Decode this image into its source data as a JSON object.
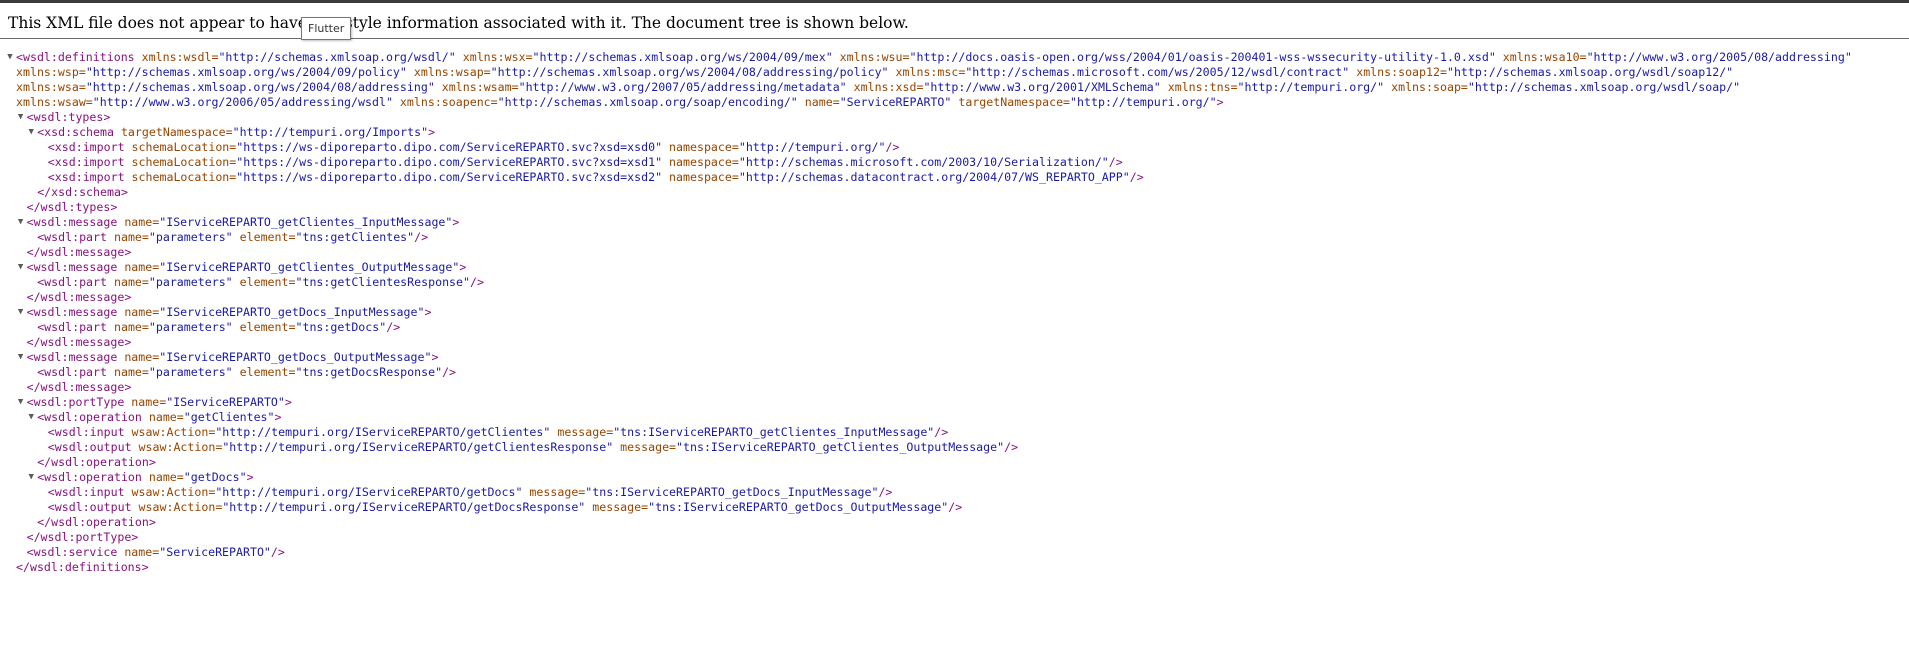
{
  "header": {
    "message": "This XML file does not appear to have any style information associated with it. The document tree is shown below.",
    "tooltip": "Flutter"
  },
  "tree": {
    "lines": [
      {
        "depth": 0,
        "toggle": true,
        "parts": [
          [
            "t",
            "<wsdl:definitions"
          ],
          [
            "an",
            " xmlns:wsdl="
          ],
          [
            "av",
            "\"http://schemas.xmlsoap.org/wsdl/\""
          ],
          [
            "an",
            " xmlns:wsx="
          ],
          [
            "av",
            "\"http://schemas.xmlsoap.org/ws/2004/09/mex\""
          ],
          [
            "an",
            " xmlns:wsu="
          ],
          [
            "av",
            "\"http://docs.oasis-open.org/wss/2004/01/oasis-200401-wss-wssecurity-utility-1.0.xsd\""
          ],
          [
            "an",
            " xmlns:wsa10="
          ],
          [
            "av",
            "\"http://www.w3.org/2005/08/addressing\""
          ]
        ]
      },
      {
        "depth": 0,
        "wrap": true,
        "parts": [
          [
            "an",
            "xmlns:wsp="
          ],
          [
            "av",
            "\"http://schemas.xmlsoap.org/ws/2004/09/policy\""
          ],
          [
            "an",
            " xmlns:wsap="
          ],
          [
            "av",
            "\"http://schemas.xmlsoap.org/ws/2004/08/addressing/policy\""
          ],
          [
            "an",
            " xmlns:msc="
          ],
          [
            "av",
            "\"http://schemas.microsoft.com/ws/2005/12/wsdl/contract\""
          ],
          [
            "an",
            " xmlns:soap12="
          ],
          [
            "av",
            "\"http://schemas.xmlsoap.org/wsdl/soap12/\""
          ]
        ]
      },
      {
        "depth": 0,
        "wrap": true,
        "parts": [
          [
            "an",
            "xmlns:wsa="
          ],
          [
            "av",
            "\"http://schemas.xmlsoap.org/ws/2004/08/addressing\""
          ],
          [
            "an",
            " xmlns:wsam="
          ],
          [
            "av",
            "\"http://www.w3.org/2007/05/addressing/metadata\""
          ],
          [
            "an",
            " xmlns:xsd="
          ],
          [
            "av",
            "\"http://www.w3.org/2001/XMLSchema\""
          ],
          [
            "an",
            " xmlns:tns="
          ],
          [
            "av",
            "\"http://tempuri.org/\""
          ],
          [
            "an",
            " xmlns:soap="
          ],
          [
            "av",
            "\"http://schemas.xmlsoap.org/wsdl/soap/\""
          ]
        ]
      },
      {
        "depth": 0,
        "wrap": true,
        "parts": [
          [
            "an",
            "xmlns:wsaw="
          ],
          [
            "av",
            "\"http://www.w3.org/2006/05/addressing/wsdl\""
          ],
          [
            "an",
            " xmlns:soapenc="
          ],
          [
            "av",
            "\"http://schemas.xmlsoap.org/soap/encoding/\""
          ],
          [
            "an",
            " name="
          ],
          [
            "av",
            "\"ServiceREPARTO\""
          ],
          [
            "an",
            " targetNamespace="
          ],
          [
            "av",
            "\"http://tempuri.org/\""
          ],
          [
            "t",
            ">"
          ]
        ]
      },
      {
        "depth": 1,
        "toggle": true,
        "parts": [
          [
            "t",
            "<wsdl:types>"
          ]
        ]
      },
      {
        "depth": 2,
        "toggle": true,
        "parts": [
          [
            "t",
            "<xsd:schema"
          ],
          [
            "an",
            " targetNamespace="
          ],
          [
            "av",
            "\"http://tempuri.org/Imports\""
          ],
          [
            "t",
            ">"
          ]
        ]
      },
      {
        "depth": 3,
        "parts": [
          [
            "t",
            "<xsd:import"
          ],
          [
            "an",
            " schemaLocation="
          ],
          [
            "av",
            "\"https://ws-diporeparto.dipo.com/ServiceREPARTO.svc?xsd=xsd0\""
          ],
          [
            "an",
            " namespace="
          ],
          [
            "av",
            "\"http://tempuri.org/\""
          ],
          [
            "t",
            "/>"
          ]
        ]
      },
      {
        "depth": 3,
        "parts": [
          [
            "t",
            "<xsd:import"
          ],
          [
            "an",
            " schemaLocation="
          ],
          [
            "av",
            "\"https://ws-diporeparto.dipo.com/ServiceREPARTO.svc?xsd=xsd1\""
          ],
          [
            "an",
            " namespace="
          ],
          [
            "av",
            "\"http://schemas.microsoft.com/2003/10/Serialization/\""
          ],
          [
            "t",
            "/>"
          ]
        ]
      },
      {
        "depth": 3,
        "parts": [
          [
            "t",
            "<xsd:import"
          ],
          [
            "an",
            " schemaLocation="
          ],
          [
            "av",
            "\"https://ws-diporeparto.dipo.com/ServiceREPARTO.svc?xsd=xsd2\""
          ],
          [
            "an",
            " namespace="
          ],
          [
            "av",
            "\"http://schemas.datacontract.org/2004/07/WS_REPARTO_APP\""
          ],
          [
            "t",
            "/>"
          ]
        ]
      },
      {
        "depth": 2,
        "parts": [
          [
            "t",
            "</xsd:schema>"
          ]
        ]
      },
      {
        "depth": 1,
        "parts": [
          [
            "t",
            "</wsdl:types>"
          ]
        ]
      },
      {
        "depth": 1,
        "toggle": true,
        "parts": [
          [
            "t",
            "<wsdl:message"
          ],
          [
            "an",
            " name="
          ],
          [
            "av",
            "\"IServiceREPARTO_getClientes_InputMessage\""
          ],
          [
            "t",
            ">"
          ]
        ]
      },
      {
        "depth": 2,
        "parts": [
          [
            "t",
            "<wsdl:part"
          ],
          [
            "an",
            " name="
          ],
          [
            "av",
            "\"parameters\""
          ],
          [
            "an",
            " element="
          ],
          [
            "av",
            "\"tns:getClientes\""
          ],
          [
            "t",
            "/>"
          ]
        ]
      },
      {
        "depth": 1,
        "parts": [
          [
            "t",
            "</wsdl:message>"
          ]
        ]
      },
      {
        "depth": 1,
        "toggle": true,
        "parts": [
          [
            "t",
            "<wsdl:message"
          ],
          [
            "an",
            " name="
          ],
          [
            "av",
            "\"IServiceREPARTO_getClientes_OutputMessage\""
          ],
          [
            "t",
            ">"
          ]
        ]
      },
      {
        "depth": 2,
        "parts": [
          [
            "t",
            "<wsdl:part"
          ],
          [
            "an",
            " name="
          ],
          [
            "av",
            "\"parameters\""
          ],
          [
            "an",
            " element="
          ],
          [
            "av",
            "\"tns:getClientesResponse\""
          ],
          [
            "t",
            "/>"
          ]
        ]
      },
      {
        "depth": 1,
        "parts": [
          [
            "t",
            "</wsdl:message>"
          ]
        ]
      },
      {
        "depth": 1,
        "toggle": true,
        "parts": [
          [
            "t",
            "<wsdl:message"
          ],
          [
            "an",
            " name="
          ],
          [
            "av",
            "\"IServiceREPARTO_getDocs_InputMessage\""
          ],
          [
            "t",
            ">"
          ]
        ]
      },
      {
        "depth": 2,
        "parts": [
          [
            "t",
            "<wsdl:part"
          ],
          [
            "an",
            " name="
          ],
          [
            "av",
            "\"parameters\""
          ],
          [
            "an",
            " element="
          ],
          [
            "av",
            "\"tns:getDocs\""
          ],
          [
            "t",
            "/>"
          ]
        ]
      },
      {
        "depth": 1,
        "parts": [
          [
            "t",
            "</wsdl:message>"
          ]
        ]
      },
      {
        "depth": 1,
        "toggle": true,
        "parts": [
          [
            "t",
            "<wsdl:message"
          ],
          [
            "an",
            " name="
          ],
          [
            "av",
            "\"IServiceREPARTO_getDocs_OutputMessage\""
          ],
          [
            "t",
            ">"
          ]
        ]
      },
      {
        "depth": 2,
        "parts": [
          [
            "t",
            "<wsdl:part"
          ],
          [
            "an",
            " name="
          ],
          [
            "av",
            "\"parameters\""
          ],
          [
            "an",
            " element="
          ],
          [
            "av",
            "\"tns:getDocsResponse\""
          ],
          [
            "t",
            "/>"
          ]
        ]
      },
      {
        "depth": 1,
        "parts": [
          [
            "t",
            "</wsdl:message>"
          ]
        ]
      },
      {
        "depth": 1,
        "toggle": true,
        "parts": [
          [
            "t",
            "<wsdl:portType"
          ],
          [
            "an",
            " name="
          ],
          [
            "av",
            "\"IServiceREPARTO\""
          ],
          [
            "t",
            ">"
          ]
        ]
      },
      {
        "depth": 2,
        "toggle": true,
        "parts": [
          [
            "t",
            "<wsdl:operation"
          ],
          [
            "an",
            " name="
          ],
          [
            "av",
            "\"getClientes\""
          ],
          [
            "t",
            ">"
          ]
        ]
      },
      {
        "depth": 3,
        "parts": [
          [
            "t",
            "<wsdl:input"
          ],
          [
            "an",
            " wsaw:Action="
          ],
          [
            "av",
            "\"http://tempuri.org/IServiceREPARTO/getClientes\""
          ],
          [
            "an",
            " message="
          ],
          [
            "av",
            "\"tns:IServiceREPARTO_getClientes_InputMessage\""
          ],
          [
            "t",
            "/>"
          ]
        ]
      },
      {
        "depth": 3,
        "parts": [
          [
            "t",
            "<wsdl:output"
          ],
          [
            "an",
            " wsaw:Action="
          ],
          [
            "av",
            "\"http://tempuri.org/IServiceREPARTO/getClientesResponse\""
          ],
          [
            "an",
            " message="
          ],
          [
            "av",
            "\"tns:IServiceREPARTO_getClientes_OutputMessage\""
          ],
          [
            "t",
            "/>"
          ]
        ]
      },
      {
        "depth": 2,
        "parts": [
          [
            "t",
            "</wsdl:operation>"
          ]
        ]
      },
      {
        "depth": 2,
        "toggle": true,
        "parts": [
          [
            "t",
            "<wsdl:operation"
          ],
          [
            "an",
            " name="
          ],
          [
            "av",
            "\"getDocs\""
          ],
          [
            "t",
            ">"
          ]
        ]
      },
      {
        "depth": 3,
        "parts": [
          [
            "t",
            "<wsdl:input"
          ],
          [
            "an",
            " wsaw:Action="
          ],
          [
            "av",
            "\"http://tempuri.org/IServiceREPARTO/getDocs\""
          ],
          [
            "an",
            " message="
          ],
          [
            "av",
            "\"tns:IServiceREPARTO_getDocs_InputMessage\""
          ],
          [
            "t",
            "/>"
          ]
        ]
      },
      {
        "depth": 3,
        "parts": [
          [
            "t",
            "<wsdl:output"
          ],
          [
            "an",
            " wsaw:Action="
          ],
          [
            "av",
            "\"http://tempuri.org/IServiceREPARTO/getDocsResponse\""
          ],
          [
            "an",
            " message="
          ],
          [
            "av",
            "\"tns:IServiceREPARTO_getDocs_OutputMessage\""
          ],
          [
            "t",
            "/>"
          ]
        ]
      },
      {
        "depth": 2,
        "parts": [
          [
            "t",
            "</wsdl:operation>"
          ]
        ]
      },
      {
        "depth": 1,
        "parts": [
          [
            "t",
            "</wsdl:portType>"
          ]
        ]
      },
      {
        "depth": 1,
        "parts": [
          [
            "t",
            "<wsdl:service"
          ],
          [
            "an",
            " name="
          ],
          [
            "av",
            "\"ServiceREPARTO\""
          ],
          [
            "t",
            "/>"
          ]
        ]
      },
      {
        "depth": 0,
        "parts": [
          [
            "t",
            "</wsdl:definitions>"
          ]
        ]
      }
    ]
  },
  "colors": {
    "tag": "#881280",
    "attr_name": "#994500",
    "attr_value": "#1a1aa6",
    "toggle": "#5a5a5a"
  }
}
